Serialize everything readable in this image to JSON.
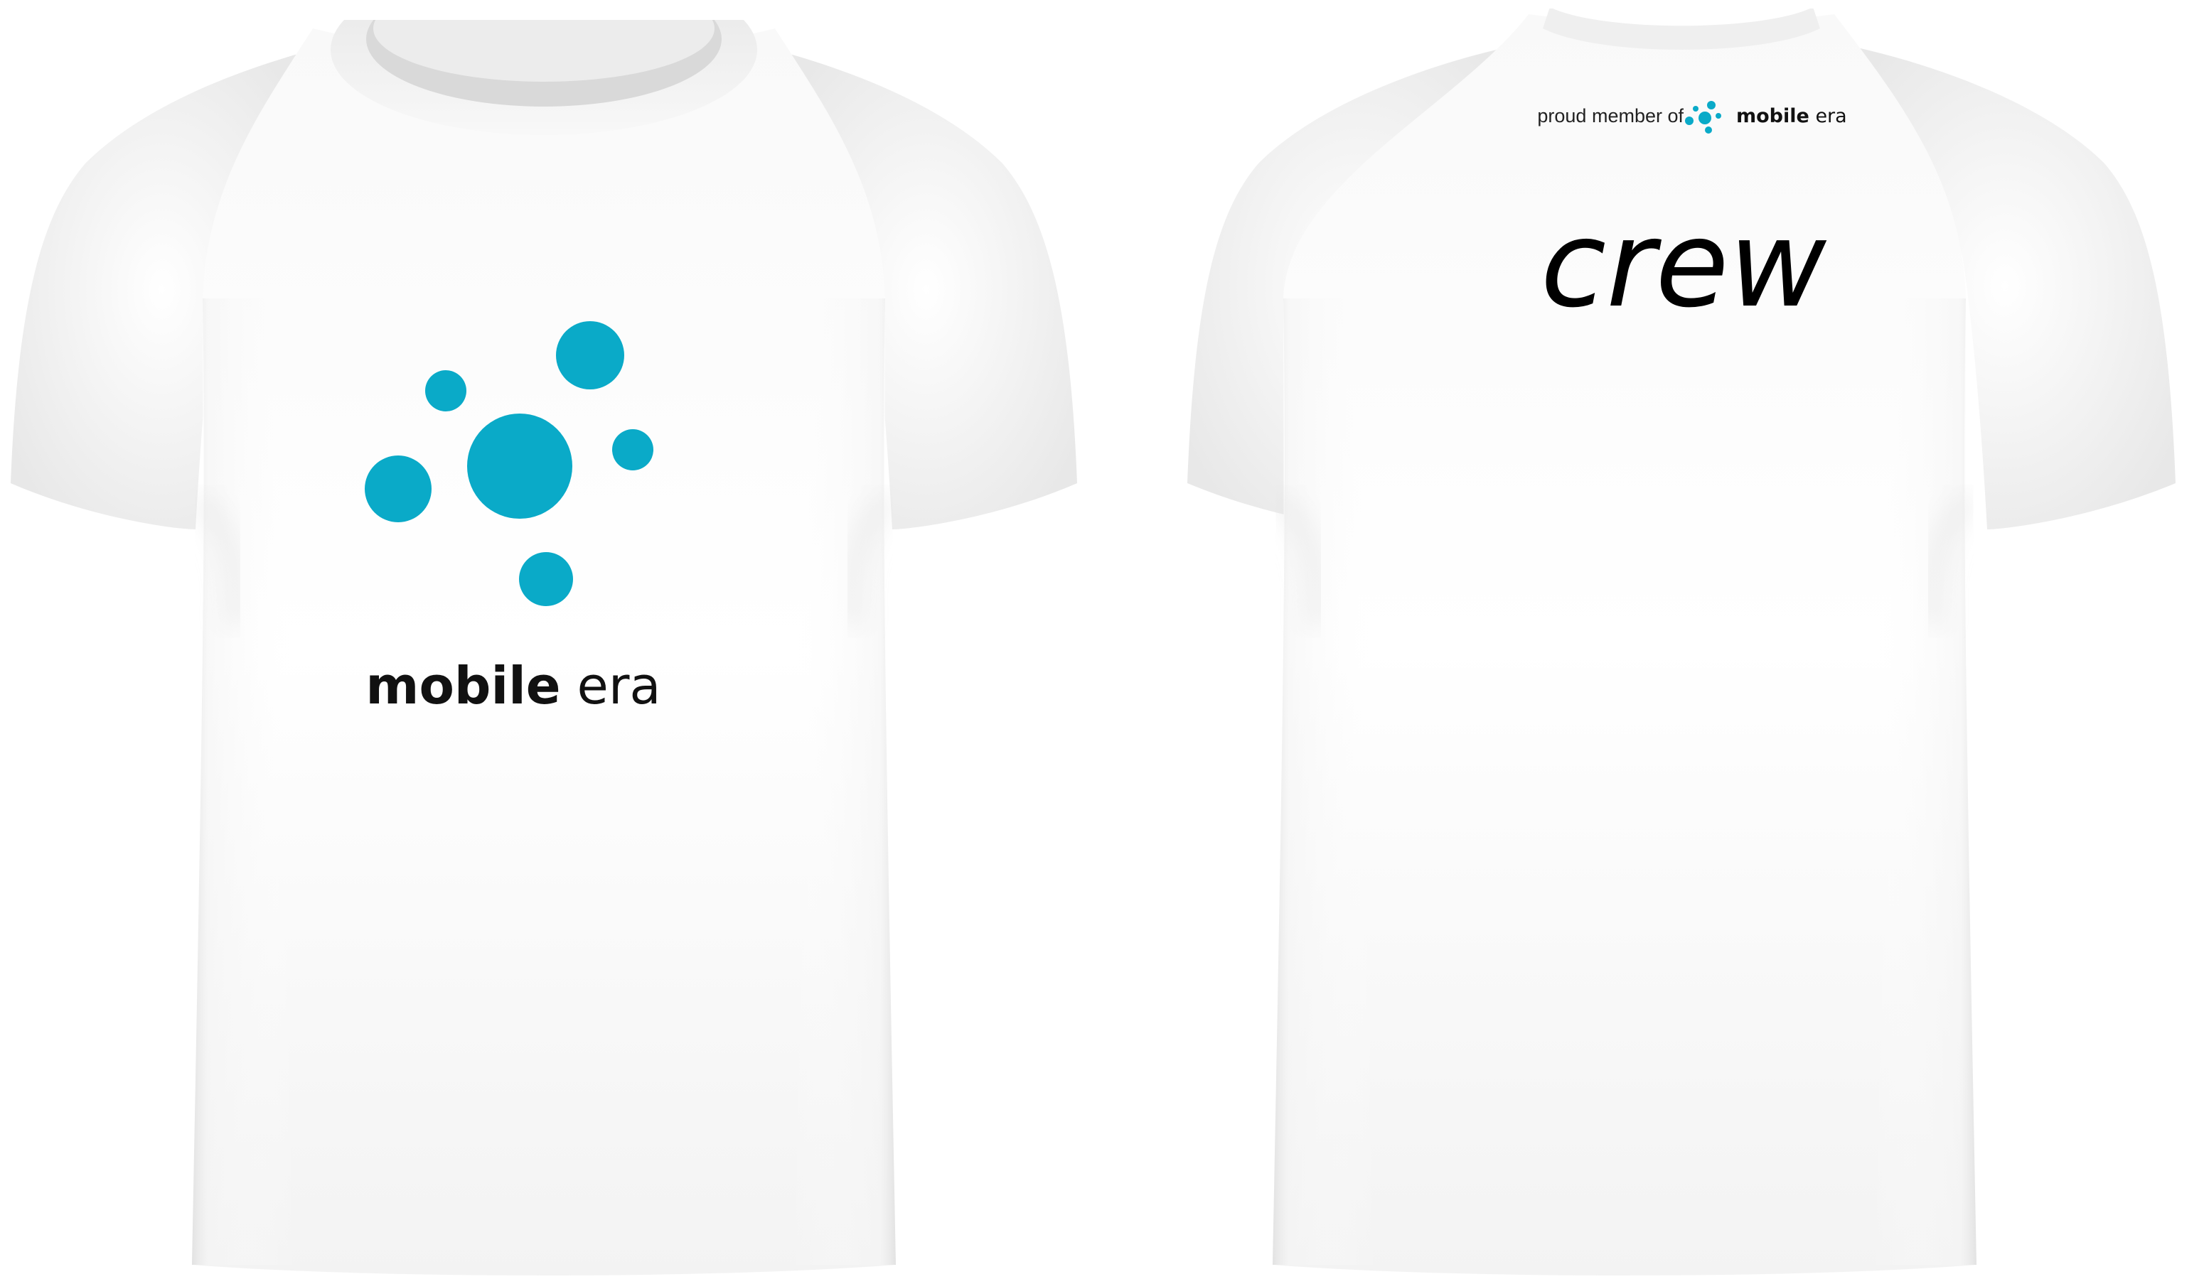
{
  "colors": {
    "background": "#ffffff",
    "shirt": "#f7f7f7",
    "shirt_shadow": "#dcdcdc",
    "brand_accent": "#0aaac8",
    "ink": "#111111"
  },
  "front": {
    "logo_icon": "dots-cluster-icon",
    "wordmark": {
      "bold": "mobile",
      "regular": "era"
    }
  },
  "back": {
    "tagline": {
      "prefix": "proud member of",
      "logo_icon": "dots-cluster-icon",
      "bold": "mobile",
      "regular": "era"
    },
    "title": "crew"
  }
}
